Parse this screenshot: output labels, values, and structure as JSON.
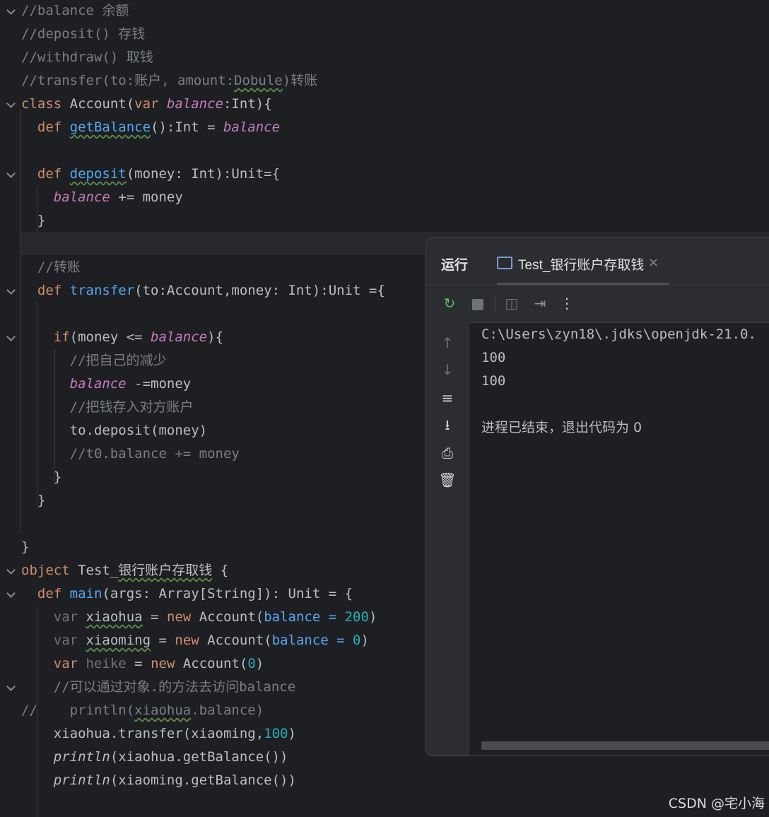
{
  "editor": {
    "lines": [
      {
        "tokens": [
          {
            "t": "//balance 余额",
            "c": "cm"
          }
        ]
      },
      {
        "tokens": [
          {
            "t": "//deposit() 存钱",
            "c": "cm"
          }
        ]
      },
      {
        "tokens": [
          {
            "t": "//withdraw() 取钱",
            "c": "cm"
          }
        ]
      },
      {
        "tokens": [
          {
            "t": "//transfer(to:账户, amount:",
            "c": "cm"
          },
          {
            "t": "Dobule",
            "c": "cm sq"
          },
          {
            "t": ")转账",
            "c": "cm"
          }
        ]
      },
      {
        "tokens": [
          {
            "t": "class ",
            "c": "kw"
          },
          {
            "t": "Account(",
            "c": ""
          },
          {
            "t": "var ",
            "c": "kw"
          },
          {
            "t": "balance",
            "c": "fld"
          },
          {
            "t": ":Int){",
            "c": ""
          }
        ]
      },
      {
        "tokens": [
          {
            "t": "  def ",
            "c": "kw"
          },
          {
            "t": "getBalance",
            "c": "fn sq"
          },
          {
            "t": "():Int = ",
            "c": ""
          },
          {
            "t": "balance",
            "c": "fld"
          }
        ]
      },
      {
        "tokens": []
      },
      {
        "tokens": [
          {
            "t": "  def ",
            "c": "kw"
          },
          {
            "t": "deposit",
            "c": "fn sq"
          },
          {
            "t": "(money: Int):Unit={",
            "c": ""
          }
        ]
      },
      {
        "tokens": [
          {
            "t": "    ",
            "c": ""
          },
          {
            "t": "balance",
            "c": "fld"
          },
          {
            "t": " += money",
            "c": ""
          }
        ]
      },
      {
        "tokens": [
          {
            "t": "  }",
            "c": ""
          }
        ]
      },
      {
        "tokens": []
      },
      {
        "tokens": [
          {
            "t": "  //转账",
            "c": "cm"
          }
        ]
      },
      {
        "tokens": [
          {
            "t": "  def ",
            "c": "kw"
          },
          {
            "t": "transfer",
            "c": "fn"
          },
          {
            "t": "(to:Account,money: Int):Unit ={",
            "c": ""
          }
        ]
      },
      {
        "tokens": []
      },
      {
        "tokens": [
          {
            "t": "    ",
            "c": ""
          },
          {
            "t": "if",
            "c": "kw"
          },
          {
            "t": "(money <= ",
            "c": ""
          },
          {
            "t": "balance",
            "c": "fld"
          },
          {
            "t": "){",
            "c": ""
          }
        ]
      },
      {
        "tokens": [
          {
            "t": "      //把自己的减少",
            "c": "cm"
          }
        ]
      },
      {
        "tokens": [
          {
            "t": "      ",
            "c": ""
          },
          {
            "t": "balance",
            "c": "fld"
          },
          {
            "t": " -=money",
            "c": ""
          }
        ]
      },
      {
        "tokens": [
          {
            "t": "      //把钱存入对方账户",
            "c": "cm"
          }
        ]
      },
      {
        "tokens": [
          {
            "t": "      to.deposit(money)",
            "c": ""
          }
        ]
      },
      {
        "tokens": [
          {
            "t": "      //t0.balance += money",
            "c": "cm"
          }
        ]
      },
      {
        "tokens": [
          {
            "t": "    }",
            "c": ""
          }
        ]
      },
      {
        "tokens": [
          {
            "t": "  }",
            "c": ""
          }
        ]
      },
      {
        "tokens": []
      },
      {
        "tokens": [
          {
            "t": "}",
            "c": ""
          }
        ]
      },
      {
        "tokens": [
          {
            "t": "object ",
            "c": "kw"
          },
          {
            "t": "Test_",
            "c": ""
          },
          {
            "t": "银行账户存取钱",
            "c": "sq"
          },
          {
            "t": " {",
            "c": ""
          }
        ]
      },
      {
        "tokens": [
          {
            "t": "  def ",
            "c": "kw"
          },
          {
            "t": "main",
            "c": "fn"
          },
          {
            "t": "(args: Array[String]): Unit = {",
            "c": ""
          }
        ]
      },
      {
        "tokens": [
          {
            "t": "    ",
            "c": ""
          },
          {
            "t": "var ",
            "c": "dim"
          },
          {
            "t": "xiaohua",
            "c": "sq"
          },
          {
            "t": " = ",
            "c": ""
          },
          {
            "t": "new ",
            "c": "kw"
          },
          {
            "t": "Account(",
            "c": ""
          },
          {
            "t": "balance = ",
            "c": "par"
          },
          {
            "t": "200",
            "c": "num"
          },
          {
            "t": ")",
            "c": ""
          }
        ]
      },
      {
        "tokens": [
          {
            "t": "    ",
            "c": ""
          },
          {
            "t": "var ",
            "c": "dim"
          },
          {
            "t": "xiaoming",
            "c": "sq"
          },
          {
            "t": " = ",
            "c": ""
          },
          {
            "t": "new ",
            "c": "kw"
          },
          {
            "t": "Account(",
            "c": ""
          },
          {
            "t": "balance = ",
            "c": "par"
          },
          {
            "t": "0",
            "c": "num"
          },
          {
            "t": ")",
            "c": ""
          }
        ]
      },
      {
        "tokens": [
          {
            "t": "    ",
            "c": ""
          },
          {
            "t": "var ",
            "c": "kw"
          },
          {
            "t": "heike",
            "c": "dim"
          },
          {
            "t": " = ",
            "c": ""
          },
          {
            "t": "new ",
            "c": "kw"
          },
          {
            "t": "Account(",
            "c": ""
          },
          {
            "t": "0",
            "c": "num"
          },
          {
            "t": ")",
            "c": ""
          }
        ]
      },
      {
        "tokens": [
          {
            "t": "    //可以通过对象.的方法去访问balance",
            "c": "cm"
          }
        ]
      },
      {
        "tokens": [
          {
            "t": "//    println(",
            "c": "cm"
          },
          {
            "t": "xiaohua",
            "c": "cm sq"
          },
          {
            "t": ".balance)",
            "c": "cm"
          }
        ]
      },
      {
        "tokens": [
          {
            "t": "    xiaohua.transfer(xiaoming,",
            "c": ""
          },
          {
            "t": "100",
            "c": "num"
          },
          {
            "t": ")",
            "c": ""
          }
        ]
      },
      {
        "tokens": [
          {
            "t": "    ",
            "c": ""
          },
          {
            "t": "println",
            "c": "it"
          },
          {
            "t": "(xiaohua.getBalance())",
            "c": ""
          }
        ]
      },
      {
        "tokens": [
          {
            "t": "    ",
            "c": ""
          },
          {
            "t": "println",
            "c": "it"
          },
          {
            "t": "(xiaoming.getBalance())",
            "c": ""
          }
        ]
      }
    ],
    "fold_markers": [
      0,
      4,
      7,
      12,
      14,
      24,
      25,
      29
    ]
  },
  "run_panel": {
    "title": "运行",
    "tab_label": "Test_银行账户存取钱",
    "tab_close": "×",
    "toolbar_icons": [
      "rerun-icon",
      "stop-icon",
      "camera-icon",
      "exit-icon",
      "more-icon"
    ],
    "side_icons": [
      "arrow-up-icon",
      "arrow-down-icon",
      "soft-wrap-icon",
      "scroll-to-end-icon",
      "print-icon",
      "trash-icon"
    ],
    "output": {
      "cmd": "C:\\Users\\zyn18\\.jdks\\openjdk-21.0.",
      "line1": "100",
      "line2": "100",
      "exit": "进程已结束，退出代码为 0"
    }
  },
  "watermark": "CSDN @宅小海"
}
